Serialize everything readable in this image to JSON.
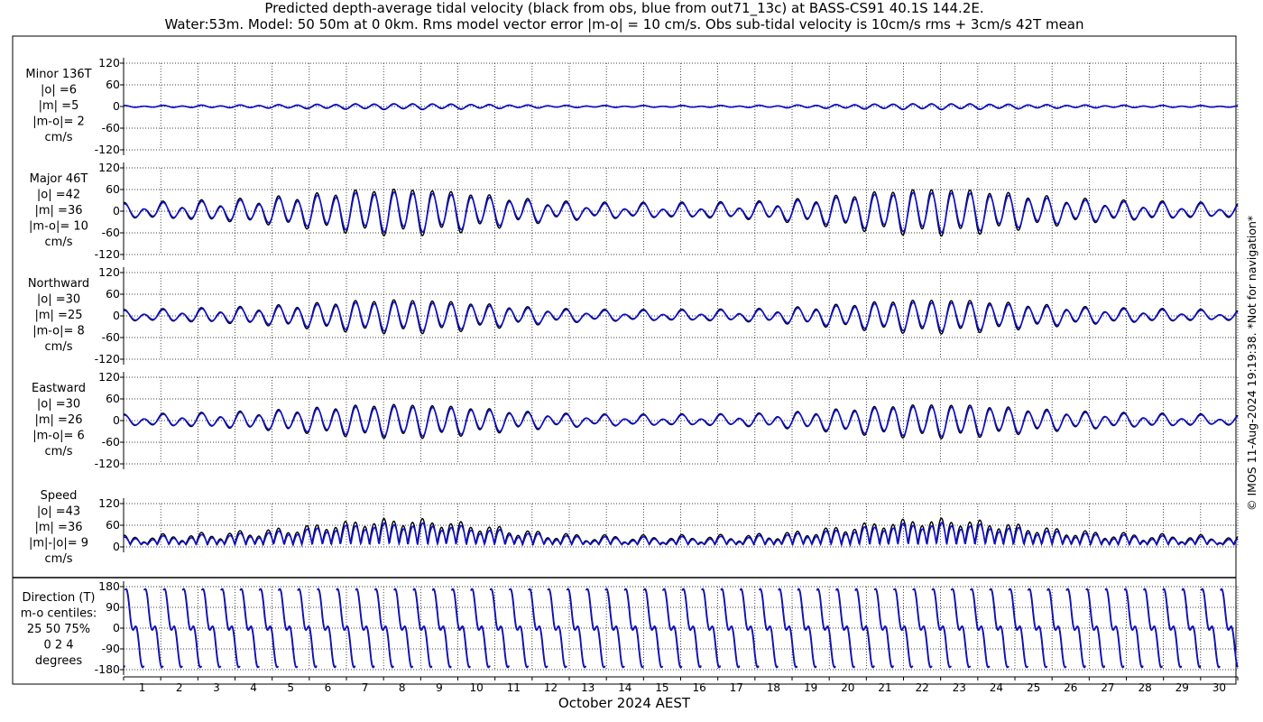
{
  "title_line1": "Predicted depth-average tidal velocity (black from obs, blue from out71_13c) at BASS-CS91 40.1S 144.2E.",
  "title_line2": "Water:53m. Model: 50 50m at 0 0km. Rms model vector error |m-o| = 10 cm/s. Obs sub-tidal velocity is 10cm/s rms + 3cm/s 42T mean",
  "xlabel": "October 2024 AEST",
  "side_note": "© IMOS 11-Aug-2024 19:19:38. *Not for navigation*",
  "colors": {
    "obs": "#000000",
    "model": "#1010d0"
  },
  "chart_data": {
    "type": "line",
    "x_days": [
      1,
      31
    ],
    "x_ticks": [
      "1",
      "2",
      "3",
      "4",
      "5",
      "6",
      "7",
      "8",
      "9",
      "10",
      "11",
      "12",
      "13",
      "14",
      "15",
      "16",
      "17",
      "18",
      "19",
      "20",
      "21",
      "22",
      "23",
      "24",
      "25",
      "26",
      "27",
      "28",
      "29",
      "30"
    ],
    "grid": true,
    "series_names": [
      "obs",
      "out71_13c"
    ],
    "panels": [
      {
        "key": "minor",
        "label_lines": [
          "Minor 136T",
          "|o| =6",
          "|m| =5",
          "|m-o|= 2",
          "cm/s"
        ],
        "ylim": [
          -120,
          120
        ],
        "yticks": [
          "120",
          "60",
          "0",
          "-60",
          "-120"
        ],
        "yvals": [
          120,
          60,
          0,
          -60,
          -120
        ],
        "kind": "vel",
        "obs_amp": 7,
        "model_amp": 6
      },
      {
        "key": "major",
        "label_lines": [
          "Major 46T",
          "|o| =42",
          "|m| =36",
          "|m-o|= 10",
          "cm/s"
        ],
        "ylim": [
          -120,
          120
        ],
        "yticks": [
          "120",
          "60",
          "0",
          "-60",
          "-120"
        ],
        "yvals": [
          120,
          60,
          0,
          -60,
          -120
        ],
        "kind": "vel",
        "obs_amp": 55,
        "model_amp": 47
      },
      {
        "key": "north",
        "label_lines": [
          "Northward",
          "|o| =30",
          "|m| =25",
          "|m-o|= 8",
          "cm/s"
        ],
        "ylim": [
          -120,
          120
        ],
        "yticks": [
          "120",
          "60",
          "0",
          "-60",
          "-120"
        ],
        "yvals": [
          120,
          60,
          0,
          -60,
          -120
        ],
        "kind": "vel",
        "obs_amp": 40,
        "model_amp": 34
      },
      {
        "key": "east",
        "label_lines": [
          "Eastward",
          "|o| =30",
          "|m| =26",
          "|m-o|= 6",
          "cm/s"
        ],
        "ylim": [
          -120,
          120
        ],
        "yticks": [
          "120",
          "60",
          "0",
          "-60",
          "-120"
        ],
        "yvals": [
          120,
          60,
          0,
          -60,
          -120
        ],
        "kind": "vel",
        "obs_amp": 40,
        "model_amp": 35
      },
      {
        "key": "speed",
        "label_lines": [
          "Speed",
          "|o| =43",
          "|m| =36",
          "|m|-|o|= 9",
          "cm/s"
        ],
        "ylim": [
          0,
          120
        ],
        "yticks": [
          "120",
          "60",
          "0"
        ],
        "yvals": [
          120,
          60,
          0
        ],
        "kind": "speed",
        "obs_amp": 58,
        "model_amp": 49
      },
      {
        "key": "dir",
        "label_lines": [
          "Direction (T)",
          "m-o centiles:",
          "25  50  75%",
          "0   2   4",
          "degrees"
        ],
        "ylim": [
          -180,
          180
        ],
        "yticks": [
          "180",
          "90",
          "0",
          "-90",
          "-180"
        ],
        "yvals": [
          180,
          90,
          0,
          -90,
          -180
        ],
        "kind": "dir",
        "obs_amp": 1,
        "model_amp": 1
      }
    ]
  }
}
